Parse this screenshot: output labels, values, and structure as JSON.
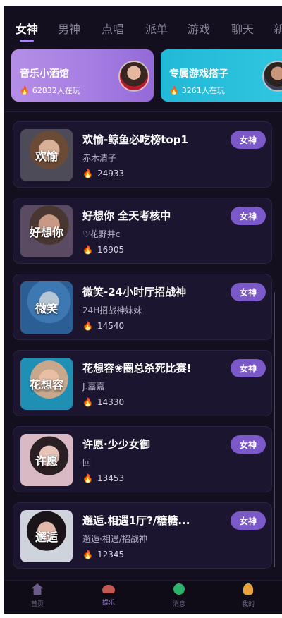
{
  "tabs": [
    "女神",
    "男神",
    "点唱",
    "派单",
    "游戏",
    "聊天",
    "新"
  ],
  "active_tab": "女神",
  "banners": [
    {
      "title": "音乐小酒馆",
      "count": "62832人在玩"
    },
    {
      "title": "专属游戏搭子",
      "count": "3261人在玩"
    }
  ],
  "rooms": [
    {
      "thumb_label": "欢愉",
      "title": "欢愉-鲸鱼必吃榜top1",
      "subtitle": "赤木清子",
      "count": "24933",
      "badge": "女神"
    },
    {
      "thumb_label": "好想你",
      "title": "好想你 全天考核中",
      "subtitle": "♡花野井c",
      "count": "16905",
      "badge": "女神"
    },
    {
      "thumb_label": "微笑",
      "title": "微笑-24小时厅招战神",
      "subtitle": "24H招战神妹妹",
      "count": "14540",
      "badge": "女神"
    },
    {
      "thumb_label": "花想容",
      "title": "花想容❀圈总杀死比赛!",
      "subtitle": "J.嘉嘉",
      "count": "14330",
      "badge": "女神"
    },
    {
      "thumb_label": "许愿",
      "title": "许愿·少少女御",
      "subtitle": "回",
      "count": "13453",
      "badge": "女神"
    },
    {
      "thumb_label": "邂逅",
      "title": "邂逅.相遇1厅?/糖糖...",
      "subtitle": "邂逅·相遇/招战神",
      "count": "12345",
      "badge": "女神"
    }
  ],
  "bottom_nav": [
    "首页",
    "娱乐",
    "消息",
    "我的"
  ],
  "active_nav": "娱乐",
  "colors": {
    "accent": "#7c59c9",
    "background": "#140f1f",
    "card": "#1b1530"
  }
}
